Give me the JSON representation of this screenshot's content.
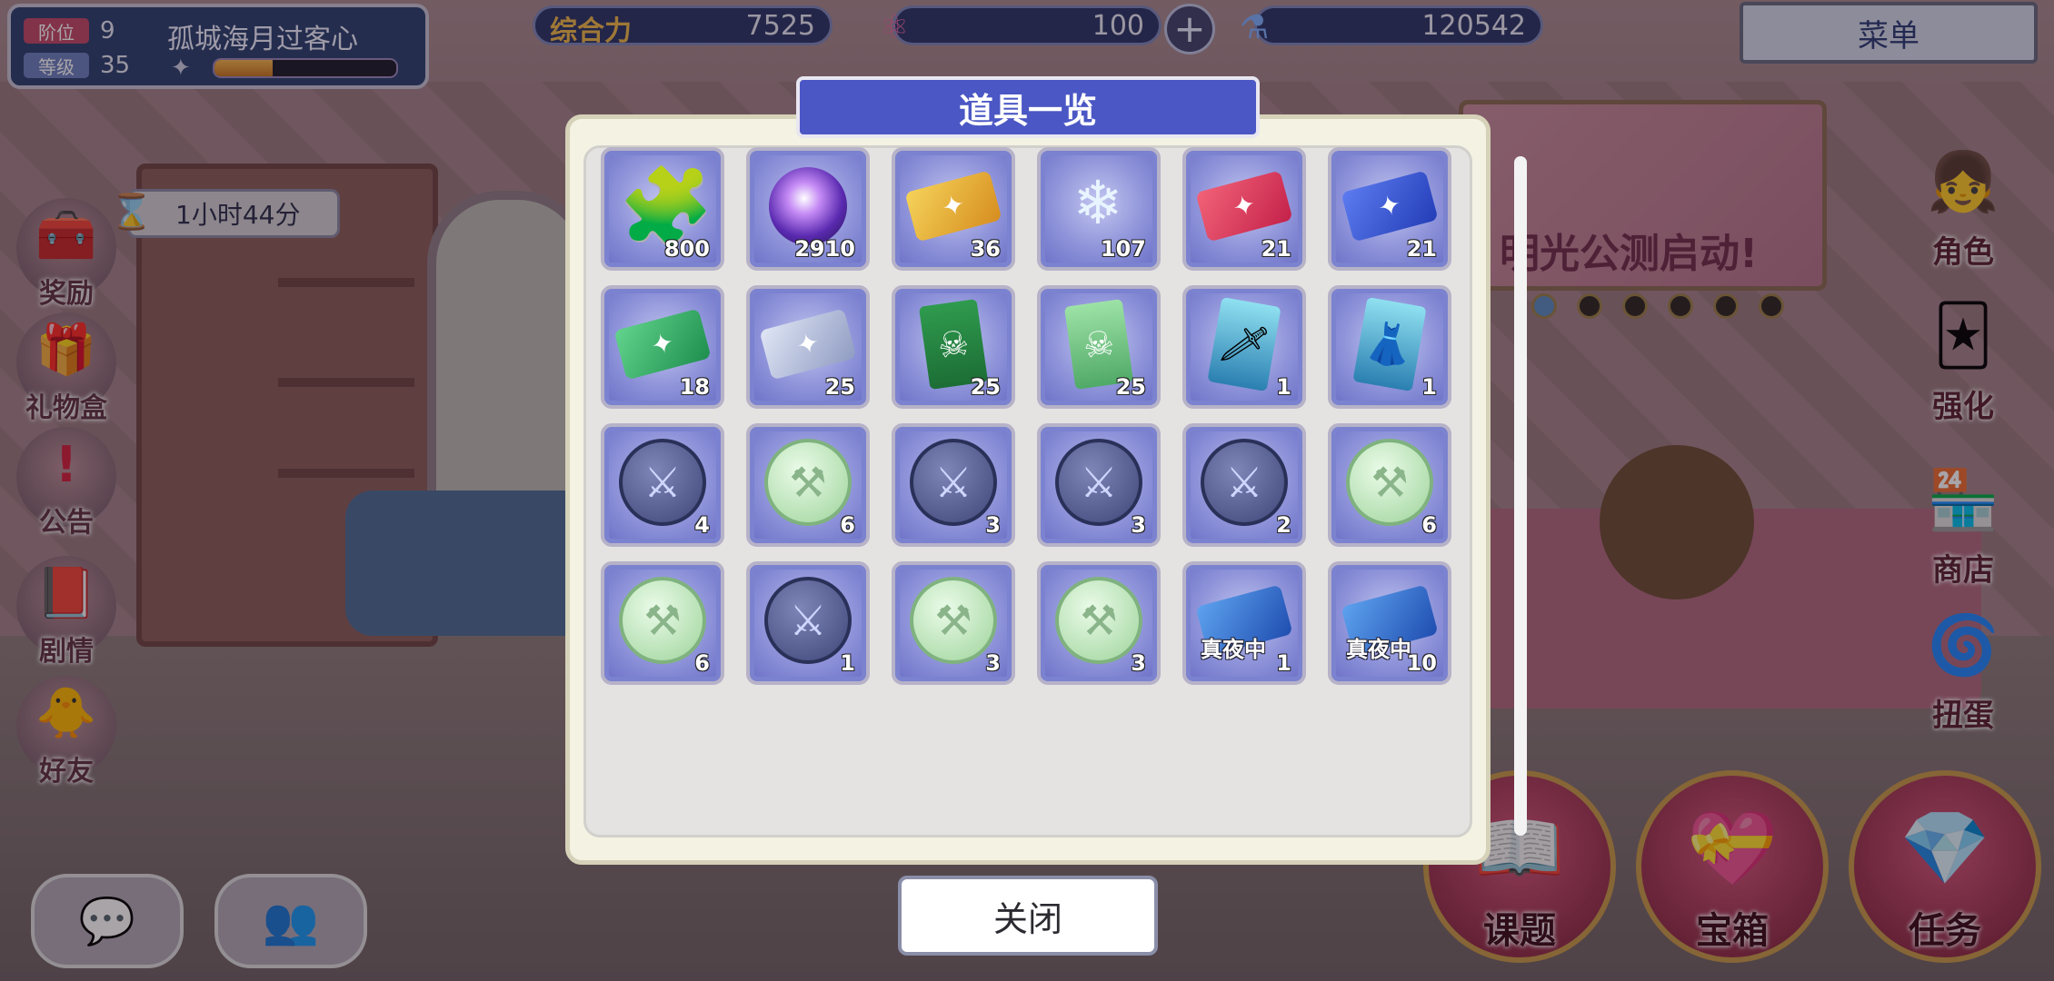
{
  "player": {
    "rank_label": "阶位",
    "rank_value": "9",
    "level_label": "等级",
    "level_value": "35",
    "name": "孤城海月过客心",
    "exp_fraction": 0.32
  },
  "hud": {
    "power_label": "综合力",
    "power_value": "7525",
    "stamina_value": "100",
    "currency_value": "120542",
    "menu_label": "菜单"
  },
  "timer": {
    "text": "1小时44分"
  },
  "left_menu": [
    {
      "label": "奖励",
      "icon": "chest-icon"
    },
    {
      "label": "礼物盒",
      "icon": "gift-icon"
    },
    {
      "label": "公告",
      "icon": "exclamation-icon"
    },
    {
      "label": "剧情",
      "icon": "book-icon"
    },
    {
      "label": "好友",
      "icon": "chick-icon"
    }
  ],
  "right_menu": [
    {
      "label": "角色",
      "icon": "character-icon"
    },
    {
      "label": "强化",
      "icon": "cards-icon"
    },
    {
      "label": "商店",
      "icon": "shop-icon"
    },
    {
      "label": "扭蛋",
      "icon": "gacha-icon"
    }
  ],
  "bottom_right": [
    {
      "label": "课题",
      "icon": "notebook-icon"
    },
    {
      "label": "宝箱",
      "icon": "treasure-icon"
    },
    {
      "label": "任务",
      "icon": "crystal-icon"
    }
  ],
  "banner": {
    "text": "明光公测启动!"
  },
  "modal": {
    "title": "道具一览",
    "close_label": "关闭",
    "items": [
      {
        "icon": "puzzle-icon",
        "qty": "800",
        "tag": ""
      },
      {
        "icon": "purple-orb-icon",
        "qty": "2910",
        "tag": ""
      },
      {
        "icon": "gold-ticket-icon",
        "qty": "36",
        "tag": ""
      },
      {
        "icon": "crystal-flower-icon",
        "qty": "107",
        "tag": ""
      },
      {
        "icon": "red-ticket-icon",
        "qty": "21",
        "tag": ""
      },
      {
        "icon": "blue-ticket-icon",
        "qty": "21",
        "tag": ""
      },
      {
        "icon": "green-ticket-icon",
        "qty": "18",
        "tag": ""
      },
      {
        "icon": "silver-ticket-icon",
        "qty": "25",
        "tag": ""
      },
      {
        "icon": "green-flag-icon",
        "qty": "25",
        "tag": ""
      },
      {
        "icon": "light-green-flag-icon",
        "qty": "25",
        "tag": ""
      },
      {
        "icon": "sword-card-icon",
        "qty": "1",
        "tag": ""
      },
      {
        "icon": "dress-card-icon",
        "qty": "1",
        "tag": ""
      },
      {
        "icon": "blue-coin-icon",
        "qty": "4",
        "tag": ""
      },
      {
        "icon": "green-coin-icon",
        "qty": "6",
        "tag": ""
      },
      {
        "icon": "blue-coin-icon",
        "qty": "3",
        "tag": ""
      },
      {
        "icon": "blue-coin-icon",
        "qty": "3",
        "tag": ""
      },
      {
        "icon": "blue-coin-icon",
        "qty": "2",
        "tag": ""
      },
      {
        "icon": "green-coin-icon",
        "qty": "6",
        "tag": ""
      },
      {
        "icon": "green-coin-icon",
        "qty": "6",
        "tag": ""
      },
      {
        "icon": "blue-coin-icon",
        "qty": "1",
        "tag": ""
      },
      {
        "icon": "green-coin-icon",
        "qty": "3",
        "tag": ""
      },
      {
        "icon": "green-coin-icon",
        "qty": "3",
        "tag": ""
      },
      {
        "icon": "night-ticket-icon",
        "qty": "1",
        "tag": "真夜中"
      },
      {
        "icon": "night-ticket-icon",
        "qty": "10",
        "tag": "真夜中"
      }
    ]
  }
}
